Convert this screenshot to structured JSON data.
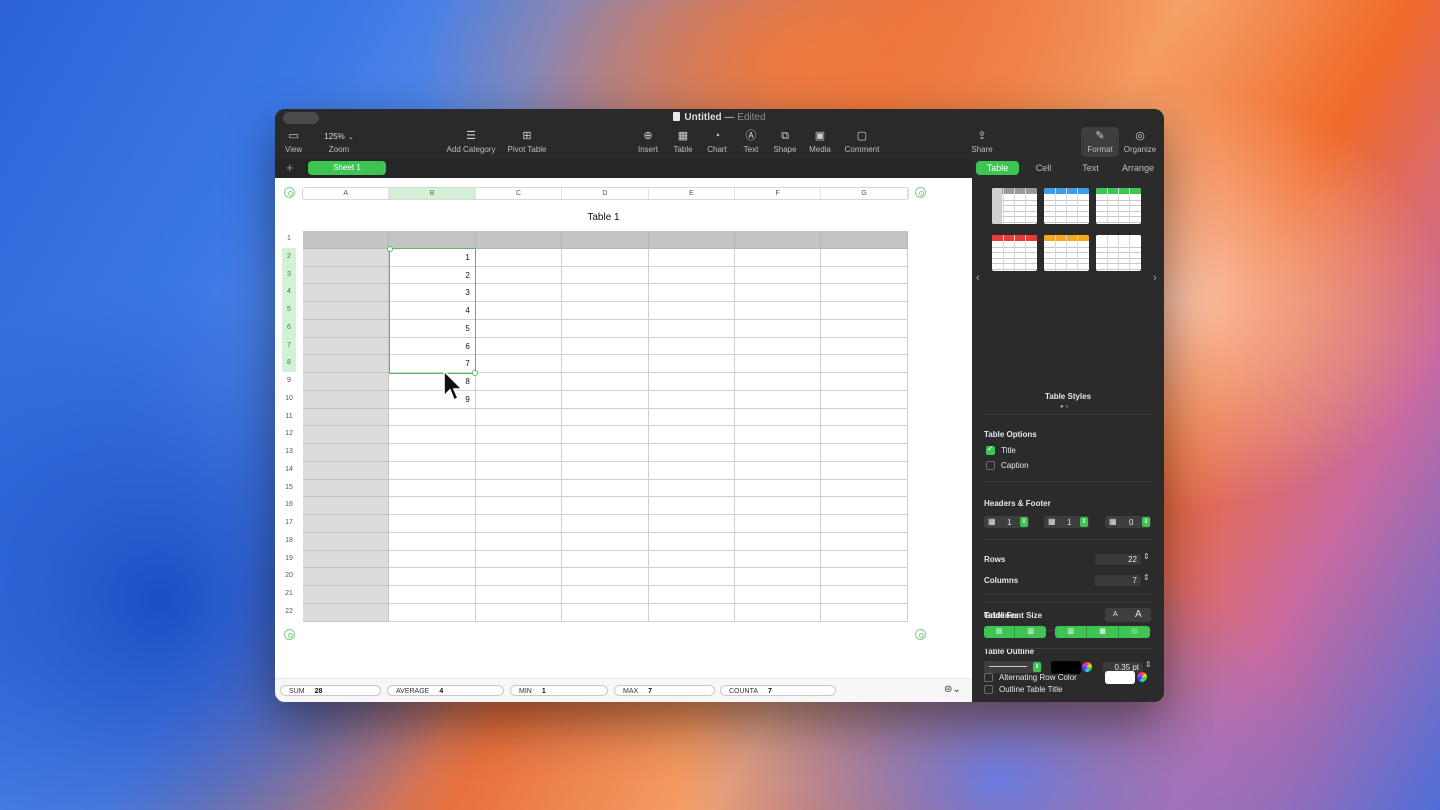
{
  "window": {
    "title": "Untitled",
    "status": "Edited"
  },
  "toolbar": {
    "items": [
      {
        "label": "View",
        "icon": "sidebar-icon"
      },
      {
        "label": "Zoom",
        "value": "125%"
      },
      {
        "label": "Add Category",
        "icon": "list-icon"
      },
      {
        "label": "Pivot Table",
        "icon": "pivot-table-icon"
      },
      {
        "label": "Insert",
        "icon": "insert-icon"
      },
      {
        "label": "Table",
        "icon": "table-icon"
      },
      {
        "label": "Chart",
        "icon": "chart-icon"
      },
      {
        "label": "Text",
        "icon": "text-box-icon"
      },
      {
        "label": "Shape",
        "icon": "shape-icon"
      },
      {
        "label": "Media",
        "icon": "media-icon"
      },
      {
        "label": "Comment",
        "icon": "comment-icon"
      },
      {
        "label": "Share",
        "icon": "share-icon"
      },
      {
        "label": "Format",
        "icon": "paintbrush-icon"
      },
      {
        "label": "Organize",
        "icon": "organize-icon"
      }
    ]
  },
  "tabs": {
    "add": "+",
    "sheet": "Sheet 1"
  },
  "table": {
    "title": "Table 1",
    "columns": [
      "A",
      "B",
      "C",
      "D",
      "E",
      "F",
      "G"
    ],
    "rows": [
      "1",
      "2",
      "3",
      "4",
      "5",
      "6",
      "7",
      "8",
      "9",
      "10",
      "11",
      "12",
      "13",
      "14",
      "15",
      "16",
      "17",
      "18",
      "19",
      "20",
      "21",
      "22"
    ],
    "b_values": [
      "",
      "1",
      "2",
      "3",
      "4",
      "5",
      "6",
      "7",
      "8",
      "9"
    ],
    "selected_column": "B",
    "selected_rows": [
      "2",
      "3",
      "4",
      "5",
      "6",
      "7",
      "8"
    ]
  },
  "statusbar": {
    "sum": {
      "label": "SUM",
      "value": "28"
    },
    "average": {
      "label": "AVERAGE",
      "value": "4"
    },
    "min": {
      "label": "MIN",
      "value": "1"
    },
    "max": {
      "label": "MAX",
      "value": "7"
    },
    "counta": {
      "label": "COUNTA",
      "value": "7"
    }
  },
  "sidebar": {
    "tabs": [
      "Table",
      "Cell",
      "Text",
      "Arrange"
    ],
    "active_tab": "Table",
    "styles_label": "Table Styles",
    "style_accents": [
      "#9a9a9a",
      "#3d9be9",
      "#3ec453",
      "#e83a3a",
      "#f4a81d",
      "#ffffff"
    ],
    "table_options": {
      "heading": "Table Options",
      "title": "Title",
      "title_checked": true,
      "caption": "Caption",
      "caption_checked": false
    },
    "headers_footer": {
      "heading": "Headers & Footer",
      "header_rows": "1",
      "header_columns": "1",
      "footer_rows": "0"
    },
    "rows": {
      "label": "Rows",
      "value": "22"
    },
    "columns": {
      "label": "Columns",
      "value": "7"
    },
    "font_size": {
      "label": "Table Font Size",
      "small": "A",
      "large": "A"
    },
    "outline": {
      "heading": "Table Outline",
      "width": "0.35 pt",
      "color": "#000000",
      "outline_title": "Outline Table Title"
    },
    "gridlines": {
      "heading": "Gridlines"
    },
    "alternating": {
      "label": "Alternating Row Color",
      "color": "#ffffff"
    }
  }
}
